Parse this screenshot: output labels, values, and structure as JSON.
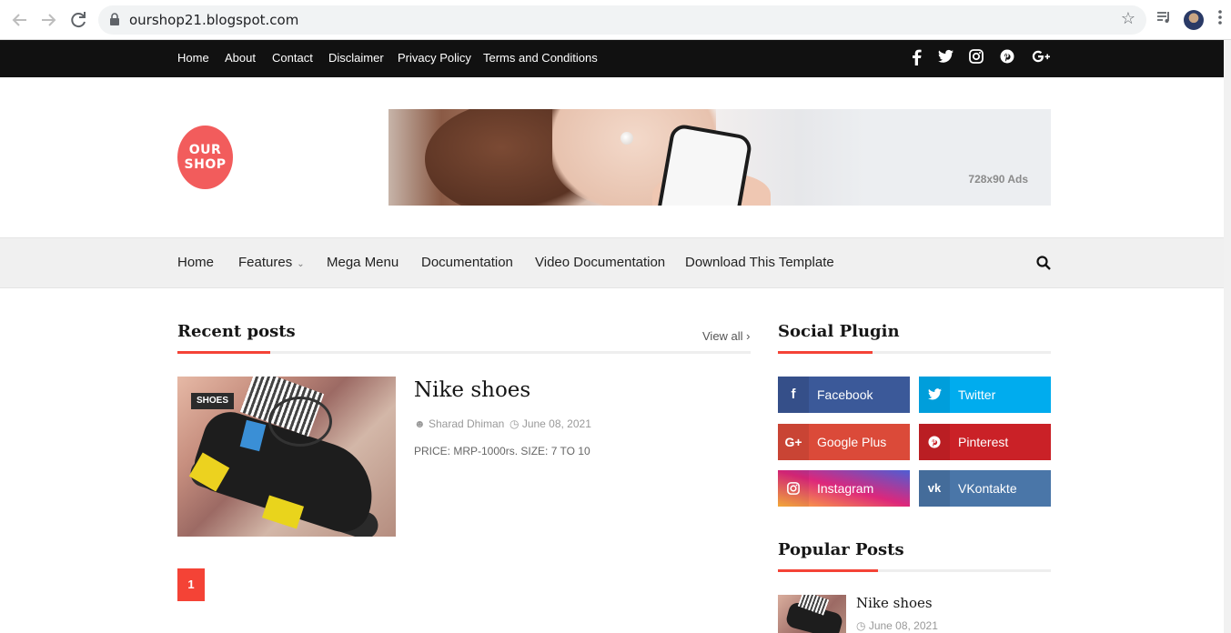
{
  "browser": {
    "url": "ourshop21.blogspot.com",
    "icons": [
      "back-arrow-icon",
      "forward-arrow-icon",
      "reload-icon",
      "lock-icon",
      "bookmark-star-icon",
      "reading-list-icon",
      "profile-avatar",
      "more-menu-icon"
    ]
  },
  "topbar": {
    "links": [
      "Home",
      "About",
      "Contact",
      "Disclaimer",
      "Privacy Policy",
      "Terms and Conditions"
    ],
    "social_icons": [
      "facebook-icon",
      "twitter-icon",
      "instagram-icon",
      "pinterest-icon",
      "google-plus-icon"
    ]
  },
  "header": {
    "logo_line1": "OUR",
    "logo_line2": "SHOP",
    "ad_label": "728x90 Ads"
  },
  "mainnav": {
    "items": [
      "Home",
      "Features",
      "Mega Menu",
      "Documentation",
      "Video Documentation",
      "Download This Template"
    ]
  },
  "recent": {
    "title": "Recent posts",
    "view_all": "View all"
  },
  "post": {
    "category": "SHOES",
    "title": "Nike shoes",
    "author": "Sharad Dhiman",
    "date": "June 08, 2021",
    "excerpt": "PRICE: MRP-1000rs. SIZE: 7 TO 10"
  },
  "pagination": {
    "current": "1"
  },
  "social_plugin": {
    "title": "Social Plugin",
    "buttons": [
      {
        "label": "Facebook",
        "color": "#3b5999"
      },
      {
        "label": "Twitter",
        "color": "#00acee"
      },
      {
        "label": "Google Plus",
        "color": "#db4a39"
      },
      {
        "label": "Pinterest",
        "color": "#ca2127"
      },
      {
        "label": "Instagram",
        "color": "#dd2a7b"
      },
      {
        "label": "VKontakte",
        "color": "#4a76a8"
      }
    ]
  },
  "popular": {
    "title": "Popular Posts",
    "post_title": "Nike shoes",
    "post_date": "June 08, 2021"
  },
  "colors": {
    "accent": "#f44336",
    "topbar": "#111111"
  }
}
